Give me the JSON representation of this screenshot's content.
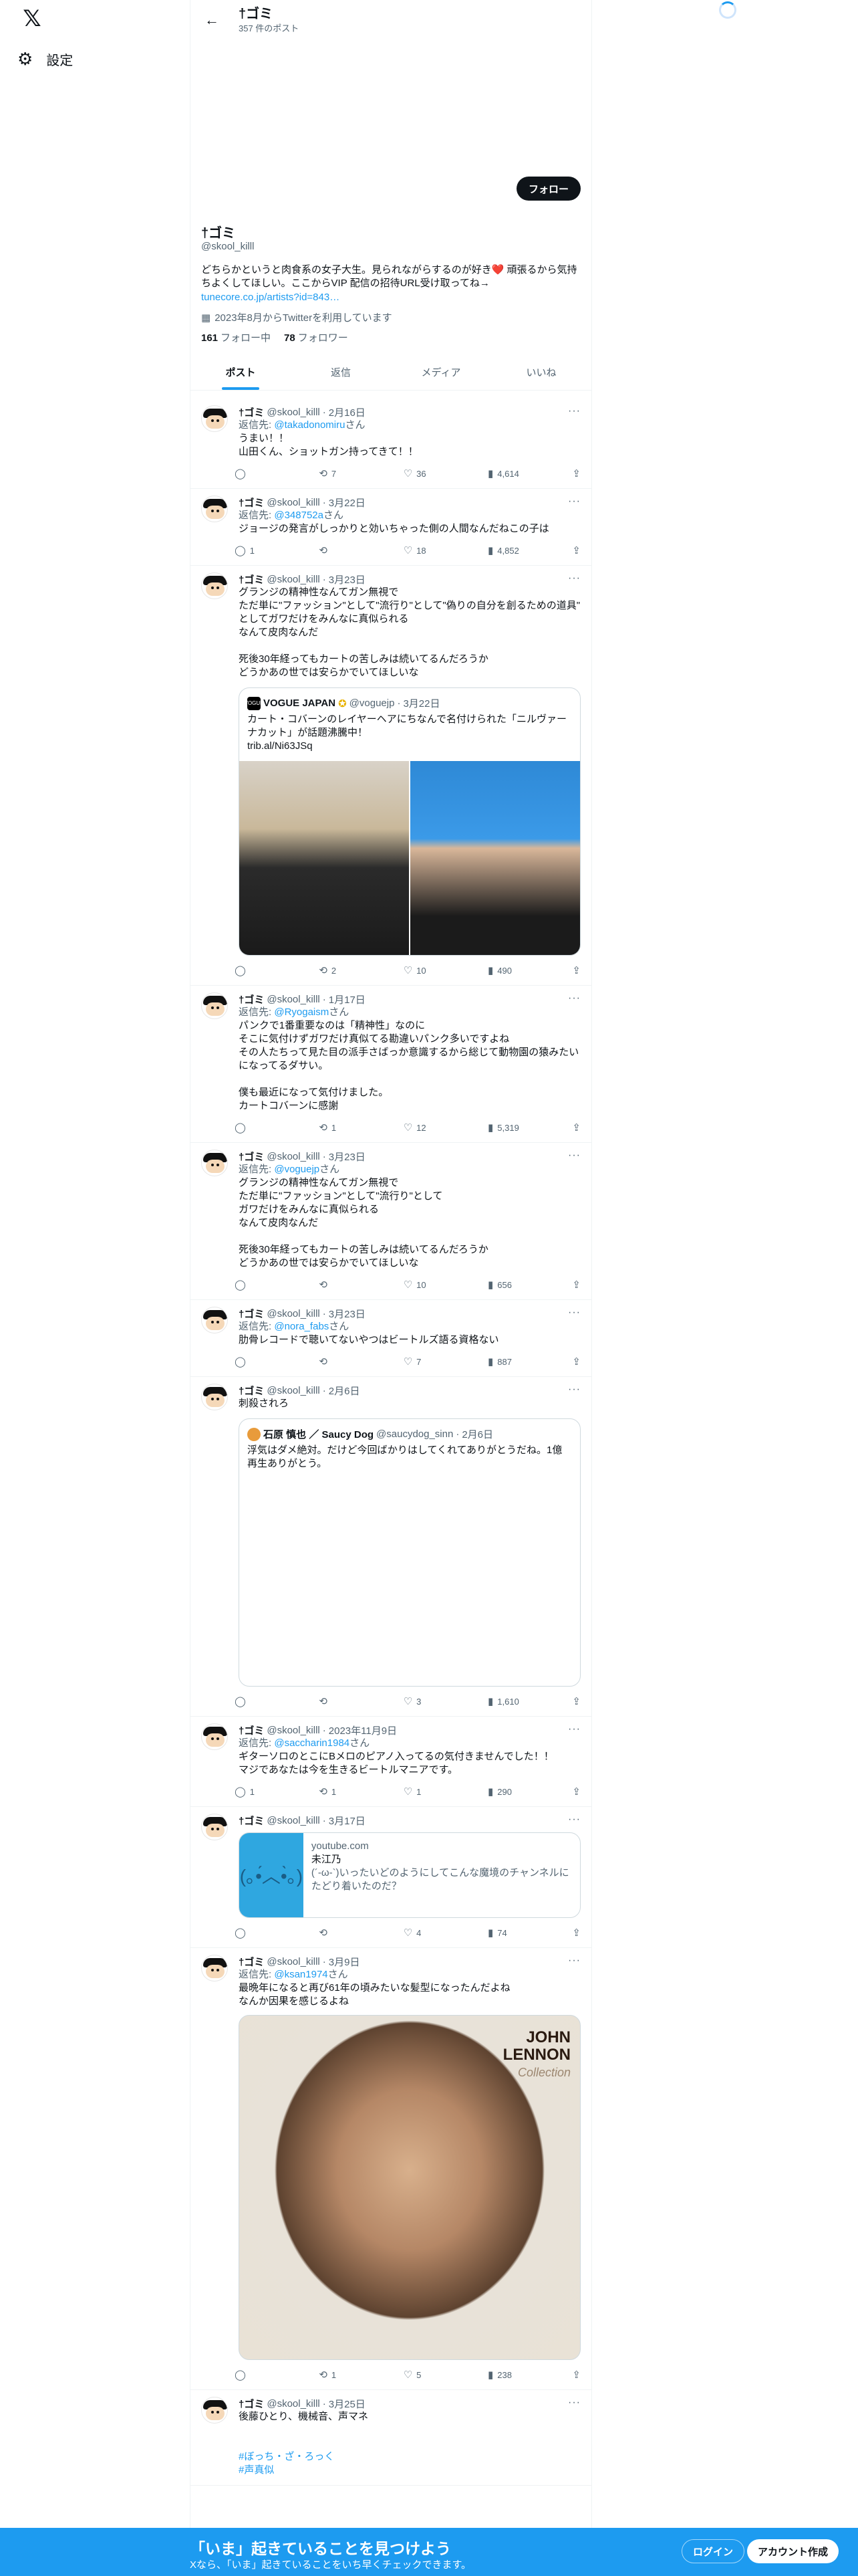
{
  "nav": {
    "logo": "𝕏",
    "settings": "設定"
  },
  "header": {
    "title": "†ゴミ",
    "post_count": "357 件のポスト"
  },
  "profile": {
    "follow": "フォロー",
    "name": "†ゴミ",
    "handle": "@skool_killl",
    "bio": "どちらかというと肉食系の女子大生。見られながらするのが好き",
    "bio_emoji": "❤️",
    "bio_rest": " 頑張るから気持ちよくしてほしい。ここからVIP 配信の招待URL受け取ってね→",
    "link": "tunecore.co.jp/artists?id=843…",
    "joined": "2023年8月からTwitterを利用しています",
    "following_count": "161",
    "following_label": "フォロー中",
    "followers_count": "78",
    "followers_label": "フォロワー"
  },
  "tabs": [
    "ポスト",
    "返信",
    "メディア",
    "いいね"
  ],
  "reply_prefix": "返信先: ",
  "reply_suffix": "さん",
  "tweets": [
    {
      "name": "†ゴミ",
      "handle": "@skool_killl",
      "date": "2月16日",
      "reply_to": "@takadonomiru",
      "text": "うまい！！\n山田くん、ショットガン持ってきて！！",
      "reply": "",
      "retweet": "7",
      "like": "36",
      "views": "4,614"
    },
    {
      "name": "†ゴミ",
      "handle": "@skool_killl",
      "date": "3月22日",
      "reply_to": "@348752a",
      "text": "ジョージの発言がしっかりと効いちゃった側の人間なんだねこの子は",
      "reply": "1",
      "retweet": "",
      "like": "18",
      "views": "4,852"
    },
    {
      "name": "†ゴミ",
      "handle": "@skool_killl",
      "date": "3月23日",
      "text": "グランジの精神性なんてガン無視で\nただ単に\"ファッション\"として\"流行り\"として\"偽りの自分を創るための道具\"\nとしてガワだけをみんなに真似られる\nなんて皮肉なんだ\n\n死後30年経ってもカートの苦しみは続いてるんだろうか\nどうかあの世では安らかでいてほしいな",
      "quote": {
        "avatar": "VOGUE",
        "name": "VOGUE JAPAN",
        "badge": "✪",
        "handle": "@voguejp",
        "date": "3月22日",
        "text": "カート・コバーンのレイヤーヘアにちなんで名付けられた「ニルヴァーナカット」が話題沸騰中！\ntrib.al/Ni63JSq"
      },
      "reply": "",
      "retweet": "2",
      "like": "10",
      "views": "490"
    },
    {
      "name": "†ゴミ",
      "handle": "@skool_killl",
      "date": "1月17日",
      "reply_to": "@Ryogaism",
      "text": "パンクで1番重要なのは「精神性」なのに\nそこに気付けずガワだけ真似てる勘違いパンク多いですよね\nその人たちって見た目の派手さばっか意識するから総じて動物園の猿みたいになってるダサい。\n\n僕も最近になって気付けました。\nカートコバーンに感謝",
      "reply": "",
      "retweet": "1",
      "like": "12",
      "views": "5,319"
    },
    {
      "name": "†ゴミ",
      "handle": "@skool_killl",
      "date": "3月23日",
      "reply_to": "@voguejp",
      "text": "グランジの精神性なんてガン無視で\nただ単に\"ファッション\"として\"流行り\"として\nガワだけをみんなに真似られる\nなんて皮肉なんだ\n\n死後30年経ってもカートの苦しみは続いてるんだろうか\nどうかあの世では安らかでいてほしいな",
      "reply": "",
      "retweet": "",
      "like": "10",
      "views": "656"
    },
    {
      "name": "†ゴミ",
      "handle": "@skool_killl",
      "date": "3月23日",
      "reply_to": "@nora_fabs",
      "text": "肋骨レコードで聴いてないやつはビートルズ語る資格ない",
      "reply": "",
      "retweet": "",
      "like": "7",
      "views": "887"
    },
    {
      "name": "†ゴミ",
      "handle": "@skool_killl",
      "date": "2月6日",
      "text": "刺殺されろ",
      "quote": {
        "avatar": "",
        "name": "石原 慎也 ／ Saucy Dog",
        "badge": "",
        "handle": "@saucydog_sinn",
        "date": "2月6日",
        "text": "浮気はダメ絶対。だけど今回ばかりはしてくれてありがとうだね。1億再生ありがとう。"
      },
      "reply": "",
      "retweet": "",
      "like": "3",
      "views": "1,610"
    },
    {
      "name": "†ゴミ",
      "handle": "@skool_killl",
      "date": "2023年11月9日",
      "reply_to": "@saccharin1984",
      "text": "ギターソロのとこにBメロのピアノ入ってるの気付きませんでした！！\nマジであなたは今を生きるビートルマニアです。",
      "reply": "1",
      "retweet": "1",
      "like": "1",
      "views": "290"
    },
    {
      "name": "†ゴミ",
      "handle": "@skool_killl",
      "date": "3月17日",
      "text": "",
      "card": {
        "domain": "youtube.com",
        "title": "未江乃",
        "desc": "(´-ω-`)いったいどのようにしてこんな魔境のチャンネルにたどり着いたのだ？"
      },
      "reply": "",
      "retweet": "",
      "like": "4",
      "views": "74"
    },
    {
      "name": "†ゴミ",
      "handle": "@skool_killl",
      "date": "3月9日",
      "reply_to": "@ksan1974",
      "text": "最晩年になると再び61年の頃みたいな髪型になったんだよね\nなんか因果を感じるよね",
      "image": {
        "title1": "JOHN",
        "title2": "LENNON",
        "subtitle": "Collection"
      },
      "reply": "",
      "retweet": "1",
      "like": "5",
      "views": "238"
    },
    {
      "name": "†ゴミ",
      "handle": "@skool_killl",
      "date": "3月25日",
      "text": "後藤ひとり、機械音、声マネ\n\n\n",
      "hashtags": "#ぼっち・ざ・ろっく\n#声真似"
    }
  ],
  "bottom": {
    "title": "「いま」起きていることを見つけよう",
    "subtitle": "Xなら、「いま」起きていることをいち早くチェックできます。",
    "login": "ログイン",
    "signup": "アカウント作成"
  }
}
